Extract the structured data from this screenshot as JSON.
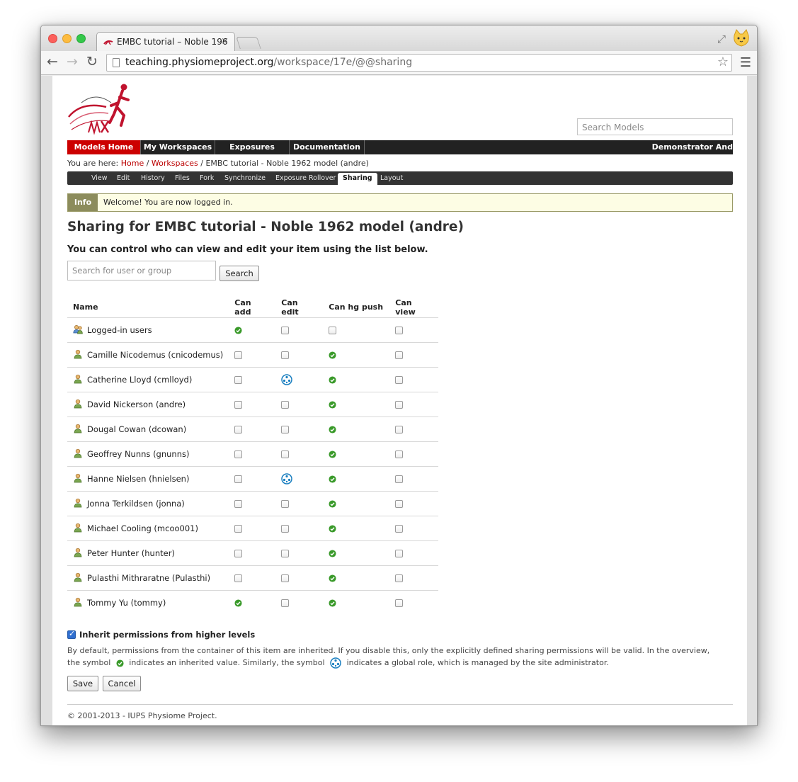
{
  "browser": {
    "tab_title": "EMBC tutorial – Noble 196",
    "url_host": "teaching.physiomeproject.org",
    "url_path": "/workspace/17e/@@sharing"
  },
  "site": {
    "search_placeholder": "Search Models",
    "nav": [
      "Models Home",
      "My Workspaces",
      "Exposures",
      "Documentation"
    ],
    "user_label": "Demonstrator And",
    "breadcrumb": {
      "prefix": "You are here: ",
      "home": "Home",
      "sep": " / ",
      "workspaces": "Workspaces",
      "current": "EMBC tutorial - Noble 1962 model (andre)"
    },
    "subnav": [
      "View",
      "Edit",
      "History",
      "Files",
      "Fork",
      "Synchronize",
      "Exposure Rollover",
      "Sharing",
      "Layout"
    ],
    "active_subnav": "Sharing"
  },
  "info": {
    "label": "Info",
    "message": "Welcome! You are now logged in."
  },
  "page": {
    "title": "Sharing for EMBC tutorial - Noble 1962 model (andre)",
    "subtitle": "You can control who can view and edit your item using the list below.",
    "user_search_placeholder": "Search for user or group",
    "search_button": "Search"
  },
  "table": {
    "headers": [
      "Name",
      "Can add",
      "Can edit",
      "Can hg push",
      "Can view"
    ],
    "rows": [
      {
        "name": "Logged-in users",
        "group": true,
        "cells": [
          "inherited",
          "unchecked",
          "unchecked",
          "unchecked"
        ]
      },
      {
        "name": "Camille Nicodemus (cnicodemus)",
        "group": false,
        "cells": [
          "unchecked",
          "unchecked",
          "inherited",
          "unchecked"
        ]
      },
      {
        "name": "Catherine Lloyd (cmlloyd)",
        "group": false,
        "cells": [
          "unchecked",
          "global",
          "inherited",
          "unchecked"
        ]
      },
      {
        "name": "David Nickerson (andre)",
        "group": false,
        "cells": [
          "unchecked",
          "unchecked",
          "inherited",
          "unchecked"
        ]
      },
      {
        "name": "Dougal Cowan (dcowan)",
        "group": false,
        "cells": [
          "unchecked",
          "unchecked",
          "inherited",
          "unchecked"
        ]
      },
      {
        "name": "Geoffrey Nunns (gnunns)",
        "group": false,
        "cells": [
          "unchecked",
          "unchecked",
          "inherited",
          "unchecked"
        ]
      },
      {
        "name": "Hanne Nielsen (hnielsen)",
        "group": false,
        "cells": [
          "unchecked",
          "global",
          "inherited",
          "unchecked"
        ]
      },
      {
        "name": "Jonna Terkildsen (jonna)",
        "group": false,
        "cells": [
          "unchecked",
          "unchecked",
          "inherited",
          "unchecked"
        ]
      },
      {
        "name": "Michael Cooling (mcoo001)",
        "group": false,
        "cells": [
          "unchecked",
          "unchecked",
          "inherited",
          "unchecked"
        ]
      },
      {
        "name": "Peter Hunter (hunter)",
        "group": false,
        "cells": [
          "unchecked",
          "unchecked",
          "inherited",
          "unchecked"
        ]
      },
      {
        "name": "Pulasthi Mithraratne (Pulasthi)",
        "group": false,
        "cells": [
          "unchecked",
          "unchecked",
          "inherited",
          "unchecked"
        ]
      },
      {
        "name": "Tommy Yu (tommy)",
        "group": false,
        "cells": [
          "inherited",
          "unchecked",
          "inherited",
          "unchecked"
        ]
      }
    ]
  },
  "inherit": {
    "label": "Inherit permissions from higher levels",
    "checked": true,
    "help_1": "By default, permissions from the container of this item are inherited. If you disable this, only the explicitly defined sharing permissions will be valid. In the overview, the symbol",
    "help_2": "indicates an inherited value. Similarly, the symbol",
    "help_3": "indicates a global role, which is managed by the site administrator."
  },
  "actions": {
    "save": "Save",
    "cancel": "Cancel"
  },
  "footer": "© 2001-2013 - IUPS Physiome Project.",
  "colors": {
    "nav_active": "#cc0000",
    "nav_bg": "#222222",
    "link": "#bb0000",
    "inherited_icon": "#3a9a2a",
    "global_icon": "#1a7fc0"
  }
}
